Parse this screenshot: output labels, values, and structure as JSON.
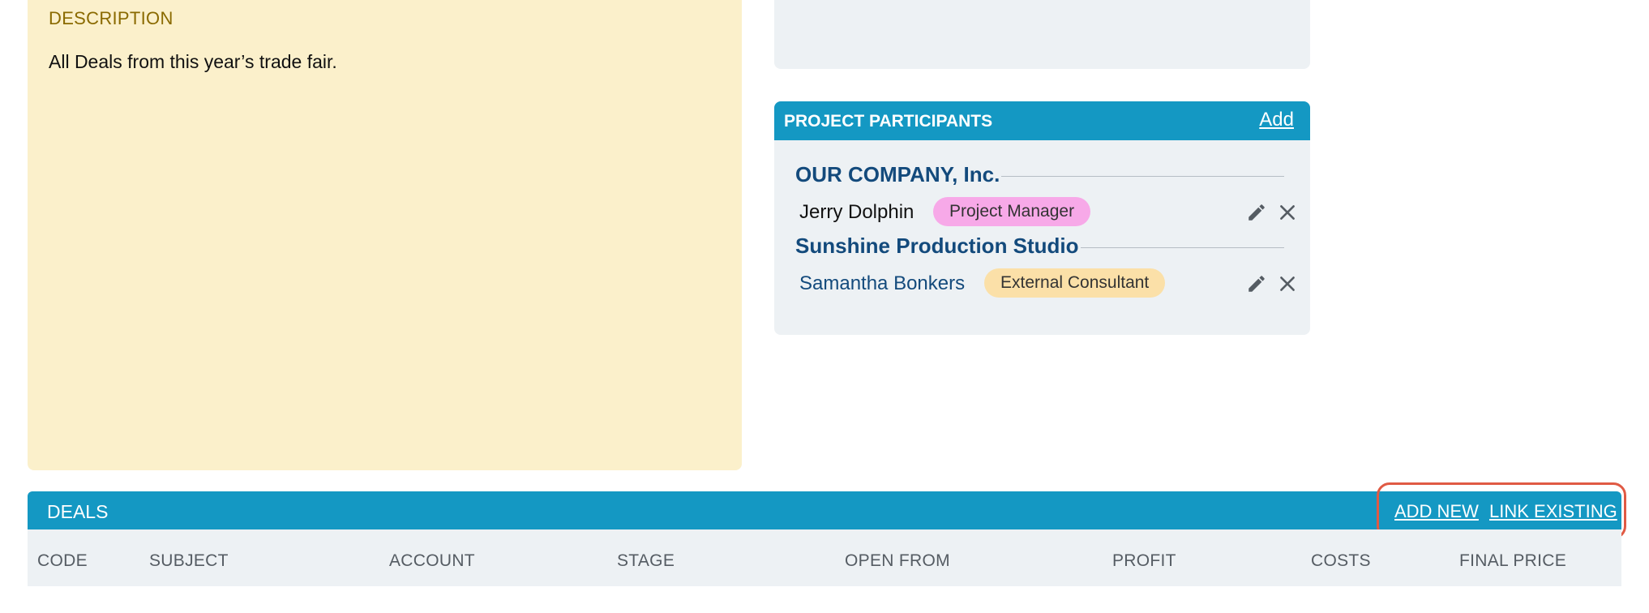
{
  "description": {
    "title": "DESCRIPTION",
    "text": "All Deals from this year’s trade fair."
  },
  "project_participants": {
    "title": "PROJECT PARTICIPANTS",
    "add_label": "Add",
    "groups": [
      {
        "company": "OUR COMPANY, Inc.",
        "person": "Jerry Dolphin",
        "role": "Project Manager",
        "role_color": "#f7a9e8",
        "name_color": "#111111"
      },
      {
        "company": "Sunshine Production Studio",
        "person": "Samantha Bonkers",
        "role": "External Consultant",
        "role_color": "#fbe0a8",
        "name_color": "#134a7c"
      }
    ],
    "icons": [
      "pencil-icon",
      "close-icon"
    ]
  },
  "deals": {
    "title": "DEALS",
    "add_new_label": "ADD NEW",
    "link_existing_label": "LINK EXISTING",
    "columns": [
      "CODE",
      "SUBJECT",
      "ACCOUNT",
      "STAGE",
      "OPEN FROM",
      "PROFIT",
      "COSTS",
      "FINAL PRICE"
    ]
  },
  "colors": {
    "header_blue": "#1498c3",
    "description_bg": "#fbf0cb",
    "panel_gray": "#edf1f4",
    "highlight": "#e05a44"
  }
}
